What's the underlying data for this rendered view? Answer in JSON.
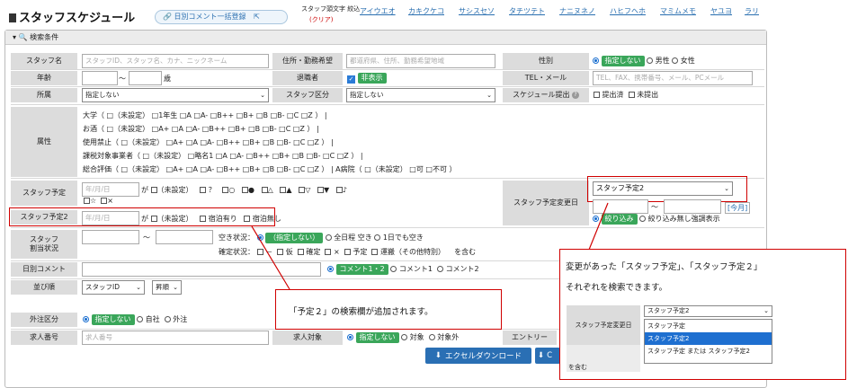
{
  "header": {
    "title": "スタッフスケジュール",
    "bulk_comment_button": "日別コメント一括登録",
    "kana_filter_label": "スタッフ頭文字 絞込",
    "kana_filter_clear": "(クリア)",
    "kana_links": [
      "アイウエオ",
      "カキクケコ",
      "サシスセソ",
      "タチツテト",
      "ナニヌネノ",
      "ハヒフヘホ",
      "マミムメモ",
      "ヤユヨ",
      "ラリ"
    ]
  },
  "search": {
    "header": "検索条件",
    "staff_name": {
      "label": "スタッフ名",
      "placeholder": "スタッフID、スタッフ名、カナ、ニックネーム"
    },
    "address": {
      "label": "住所・勤務希望",
      "placeholder": "都道府県、住所、勤務希望地域"
    },
    "gender": {
      "label": "性別",
      "options": [
        "指定しない",
        "男性",
        "女性"
      ]
    },
    "age": {
      "label": "年齢",
      "tilde": "～",
      "unit": "歳"
    },
    "retired": {
      "label": "退職者",
      "value": "非表示"
    },
    "tel": {
      "label": "TEL・メール",
      "placeholder": "TEL、FAX、携帯番号、メール、PCメール"
    },
    "affiliation": {
      "label": "所属",
      "value": "指定しない"
    },
    "staff_category": {
      "label": "スタッフ区分",
      "value": "指定しない"
    },
    "schedule_submit": {
      "label": "スケジュール提出",
      "options": [
        "提出済",
        "未提出"
      ]
    },
    "attributes": {
      "label": "属性",
      "lines": [
        "大学（ □（未設定） □1年生 □A □A- □B++ □B+ □B □B- □C □Z ） |",
        "お酒（ □（未設定） □A+ □A □A- □B++ □B+ □B □B- □C □Z ） |",
        "使用禁止（ □（未設定） □A+ □A □A- □B++ □B+ □B □B- □C □Z ） |",
        "課税対象事業者（ □（未設定） □略名1 □A □A- □B++ □B+ □B □B- □C □Z ） |",
        "総合評価（ □（未設定） □A+ □A □A- □B++ □B+ □B □B- □C □Z ） | A病院（ □（未設定） □可 □不可 ）"
      ]
    },
    "staff_plan": {
      "label": "スタッフ予定",
      "placeholder": "年/月/日",
      "ga": "が",
      "marks": [
        "（未設定）",
        "？",
        "○",
        "●",
        "△",
        "▲",
        "▽",
        "▼",
        "♪",
        "☆",
        "×"
      ]
    },
    "staff_plan2": {
      "label": "スタッフ予定2",
      "placeholder": "年/月/日",
      "ga": "が",
      "options": [
        "（未設定）",
        "宿泊有り",
        "宿泊無し"
      ]
    },
    "plan_change_date": {
      "label": "スタッフ予定変更日",
      "select_value": "スタッフ予定2",
      "tilde": "～",
      "today": "[今月]",
      "options": [
        "絞り込み",
        "絞り込み無し強調表示"
      ]
    },
    "allocation": {
      "label": "スタッフ\n割当状況",
      "tilde": "～",
      "availability_label": "空き状況：",
      "availability_options": [
        "（指定しない）",
        "全日程 空き",
        "1日でも空き"
      ],
      "confirmed_label": "確定状況：",
      "confirmed_options": [
        "－",
        "仮",
        "確定",
        "×",
        "予定",
        "運搬（その他特別）"
      ],
      "suffix": "を含む"
    },
    "daily_comment": {
      "label": "日別コメント",
      "options": [
        "コメント1・2",
        "コメント1",
        "コメント2"
      ]
    },
    "sort": {
      "label": "並び順",
      "field": "スタッフID",
      "order": "昇順"
    },
    "foreign": {
      "label": "外注区分",
      "options": [
        "指定しない",
        "自社",
        "外注"
      ]
    },
    "job_number": {
      "label": "求人番号",
      "placeholder": "求人番号"
    },
    "job_target": {
      "label": "求人対象",
      "options": [
        "指定しない",
        "対象",
        "対象外"
      ]
    },
    "entry_label": "エントリー",
    "excel_button": "エクセルダウンロード",
    "second_button": "C",
    "dropdown_options": [
      "スタッフ予定",
      "スタッフ予定2",
      "スタッフ予定 または スタッフ予定2"
    ],
    "dropdown_selected": "スタッフ予定2",
    "hidden_text": "を含む"
  },
  "annotations": {
    "callout1": "「予定２」の検索欄が追加されます。",
    "callout2_line1": "変更があった「スタッフ予定」、「スタッフ予定２」",
    "callout2_line2": "それぞれを検索できます。",
    "inset_label": "スタッフ予定変更日"
  },
  "colors": {
    "accent_blue": "#2a6fb4",
    "green": "#3aa65a",
    "red": "#d00000",
    "label_gray": "#dcdcdc"
  }
}
